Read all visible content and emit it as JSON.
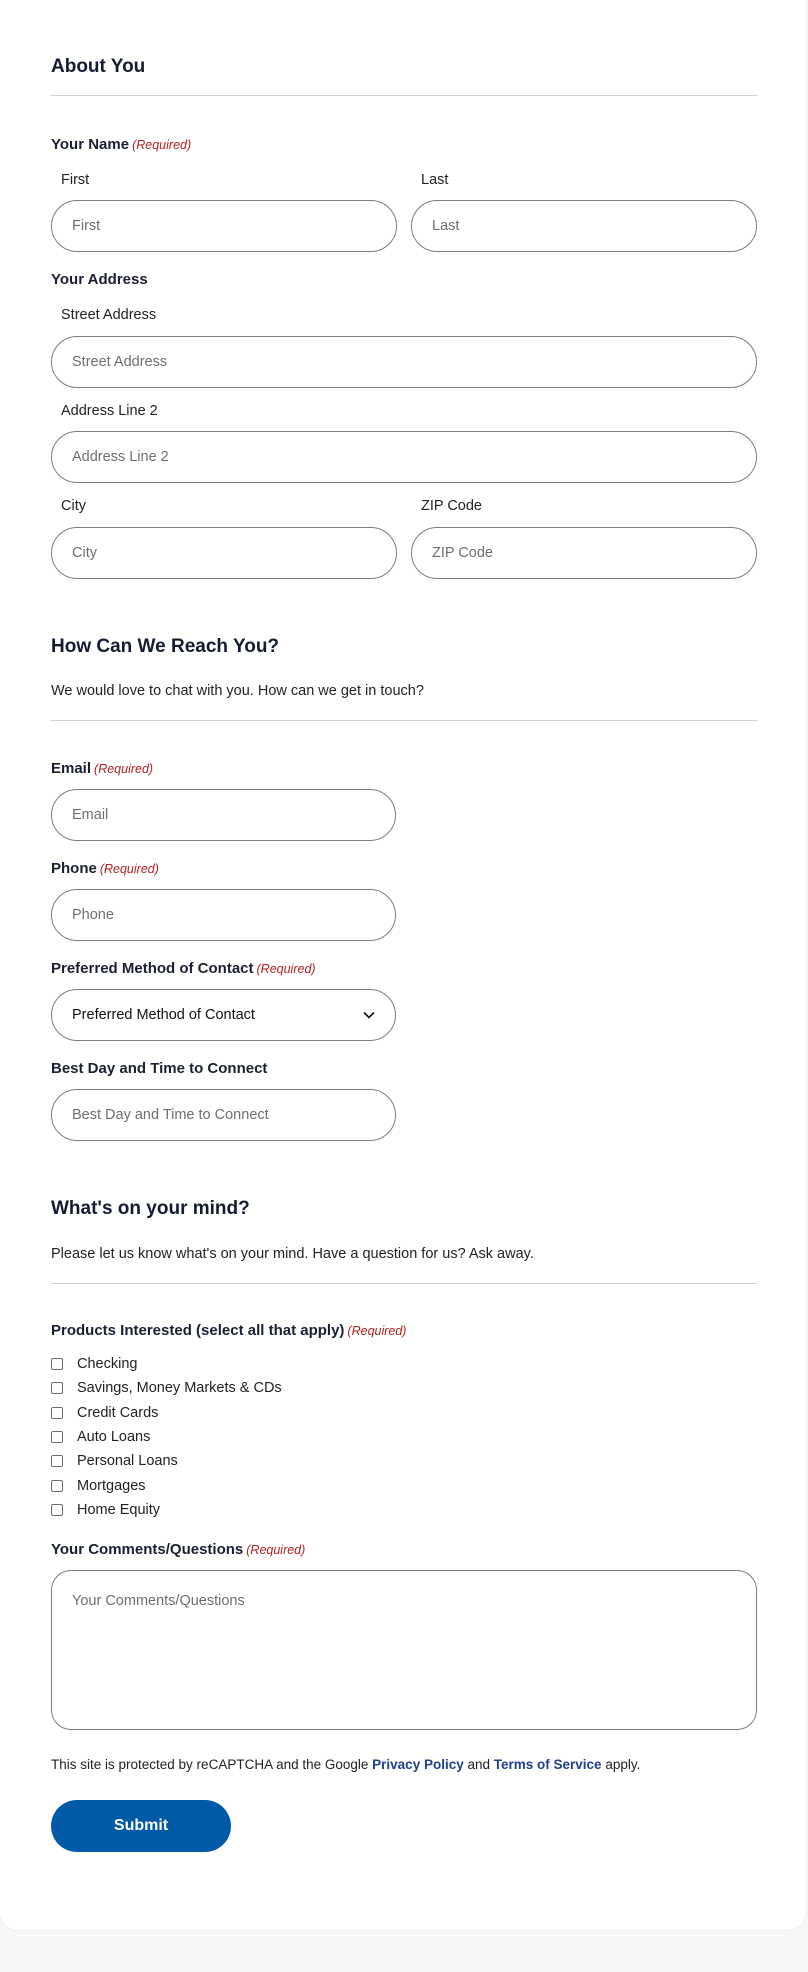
{
  "about": {
    "title": "About You",
    "name_label": "Your Name",
    "first_label": "First",
    "first_placeholder": "First",
    "last_label": "Last",
    "last_placeholder": "Last",
    "address_label": "Your Address",
    "street_label": "Street Address",
    "street_placeholder": "Street Address",
    "line2_label": "Address Line 2",
    "line2_placeholder": "Address Line 2",
    "city_label": "City",
    "city_placeholder": "City",
    "zip_label": "ZIP Code",
    "zip_placeholder": "ZIP Code"
  },
  "reach": {
    "title": "How Can We Reach You?",
    "description": "We would love to chat with you. How can we get in touch?",
    "email_label": "Email",
    "email_placeholder": "Email",
    "phone_label": "Phone",
    "phone_placeholder": "Phone",
    "method_label": "Preferred Method of Contact",
    "method_selected": "Preferred Method of Contact",
    "time_label": "Best Day and Time to Connect",
    "time_placeholder": "Best Day and Time to Connect"
  },
  "mind": {
    "title": "What's on your mind?",
    "description": "Please let us know what's on your mind. Have a question for us? Ask away.",
    "products_label": "Products Interested (select all that apply)",
    "products": [
      "Checking",
      "Savings, Money Markets & CDs",
      "Credit Cards",
      "Auto Loans",
      "Personal Loans",
      "Mortgages",
      "Home Equity"
    ],
    "comments_label": "Your Comments/Questions",
    "comments_placeholder": "Your Comments/Questions"
  },
  "required_text": "(Required)",
  "legal": {
    "prefix": "This site is protected by reCAPTCHA and the Google ",
    "privacy": "Privacy Policy",
    "and": " and ",
    "terms": "Terms of Service",
    "suffix": " apply."
  },
  "submit_label": "Submit",
  "colors": {
    "accent": "#005aa8",
    "link": "#1f3f8f",
    "required": "#b21f1f"
  }
}
